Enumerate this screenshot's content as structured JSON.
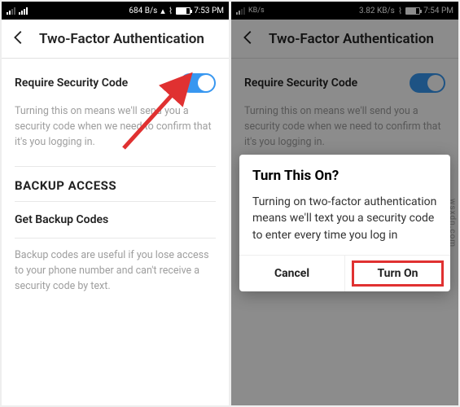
{
  "left": {
    "status": {
      "speed": "684 B/s",
      "time": "7:53 PM"
    },
    "header": "Two-Factor Authentication",
    "toggle_label": "Require Security Code",
    "desc1": "Turning this on means we'll send you a security code when we need to confirm that it's you logging in.",
    "section": "BACKUP ACCESS",
    "link": "Get Backup Codes",
    "desc2": "Backup codes are useful if you lose access to your phone number and can't receive a security code by text."
  },
  "right": {
    "status": {
      "speed": "3.82 KB/s",
      "time": "7:54 PM"
    },
    "header": "Two-Factor Authentication",
    "toggle_label": "Require Security Code",
    "desc1": "Turning this on means we'll send you a security code when we need to confirm that it's you logging in.",
    "dialog": {
      "title": "Turn This On?",
      "body": "Turning on two-factor authentication means we'll text you a security code to enter every time you log in",
      "cancel": "Cancel",
      "confirm": "Turn On"
    }
  },
  "icons": {
    "kb": "KB/s"
  },
  "watermark": "wsxdn.com",
  "colors": {
    "accent": "#3897f0",
    "highlight": "#e03131"
  }
}
